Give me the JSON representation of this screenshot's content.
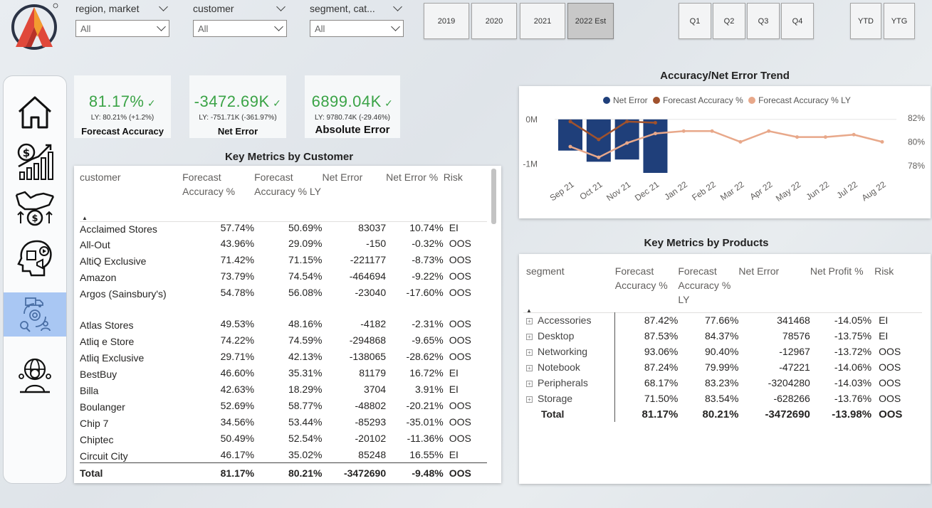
{
  "filters": [
    {
      "label": "region, market",
      "value": "All"
    },
    {
      "label": "customer",
      "value": "All"
    },
    {
      "label": "segment, cat...",
      "value": "All"
    }
  ],
  "years": [
    "2019",
    "2020",
    "2021",
    "2022 Est"
  ],
  "quarters": [
    "Q1",
    "Q2",
    "Q3",
    "Q4"
  ],
  "periods": [
    "YTD",
    "YTG"
  ],
  "kpis": [
    {
      "value": "81.17%",
      "ly": "LY: 80.21% (+1.2%)",
      "name": "Forecast Accuracy"
    },
    {
      "value": "-3472.69K",
      "ly": "LY: -751.71K (-361.97%)",
      "name": "Net Error"
    },
    {
      "value": "6899.04K",
      "ly": "LY: 9780.74K (-29.46%)",
      "name": "Absolute Error"
    }
  ],
  "customer_table": {
    "title": "Key Metrics by Customer",
    "headers": [
      "customer",
      "Forecast Accuracy %",
      "Forecast Accuracy % LY",
      "Net Error",
      "Net Error %",
      "Risk"
    ],
    "rows": [
      [
        "Acclaimed Stores",
        "57.74%",
        "50.69%",
        "83037",
        "10.74%",
        "EI"
      ],
      [
        "All-Out",
        "43.96%",
        "29.09%",
        "-150",
        "-0.32%",
        "OOS"
      ],
      [
        "AltiQ Exclusive",
        "71.42%",
        "71.15%",
        "-221177",
        "-8.73%",
        "OOS"
      ],
      [
        "Amazon",
        "73.79%",
        "74.54%",
        "-464694",
        "-9.22%",
        "OOS"
      ],
      [
        "Argos (Sainsbury's)",
        "54.78%",
        "56.08%",
        "-23040",
        "-17.60%",
        "OOS"
      ],
      [
        "Atlas Stores",
        "49.53%",
        "48.16%",
        "-4182",
        "-2.31%",
        "OOS"
      ],
      [
        "Atliq e Store",
        "74.22%",
        "74.59%",
        "-294868",
        "-9.65%",
        "OOS"
      ],
      [
        "Atliq Exclusive",
        "29.71%",
        "42.13%",
        "-138065",
        "-28.62%",
        "OOS"
      ],
      [
        "BestBuy",
        "46.60%",
        "35.31%",
        "81179",
        "16.72%",
        "EI"
      ],
      [
        "Billa",
        "42.63%",
        "18.29%",
        "3704",
        "3.91%",
        "EI"
      ],
      [
        "Boulanger",
        "52.69%",
        "58.77%",
        "-48802",
        "-20.21%",
        "OOS"
      ],
      [
        "Chip 7",
        "34.56%",
        "53.44%",
        "-85293",
        "-35.01%",
        "OOS"
      ],
      [
        "Chiptec",
        "50.49%",
        "52.54%",
        "-20102",
        "-11.36%",
        "OOS"
      ],
      [
        "Circuit City",
        "46.17%",
        "35.02%",
        "85248",
        "16.55%",
        "EI"
      ]
    ],
    "total": [
      "Total",
      "81.17%",
      "80.21%",
      "-3472690",
      "-9.48%",
      "OOS"
    ]
  },
  "product_table": {
    "title": "Key Metrics by Products",
    "headers": [
      "segment",
      "Forecast Accuracy %",
      "Forecast Accuracy % LY",
      "Net Error",
      "Net Profit %",
      "Risk"
    ],
    "rows": [
      [
        "Accessories",
        "87.42%",
        "77.66%",
        "341468",
        "-14.05%",
        "EI"
      ],
      [
        "Desktop",
        "87.53%",
        "84.37%",
        "78576",
        "-13.75%",
        "EI"
      ],
      [
        "Networking",
        "93.06%",
        "90.40%",
        "-12967",
        "-13.72%",
        "OOS"
      ],
      [
        "Notebook",
        "87.24%",
        "79.99%",
        "-47221",
        "-14.06%",
        "OOS"
      ],
      [
        "Peripherals",
        "68.17%",
        "83.23%",
        "-3204280",
        "-14.03%",
        "OOS"
      ],
      [
        "Storage",
        "71.50%",
        "83.54%",
        "-628266",
        "-13.76%",
        "OOS"
      ]
    ],
    "total": [
      "Total",
      "81.17%",
      "80.21%",
      "-3472690",
      "-13.98%",
      "OOS"
    ]
  },
  "chart_data": {
    "type": "bar",
    "title": "Accuracy/Net Error Trend",
    "categories": [
      "Sep 21",
      "Oct 21",
      "Nov 21",
      "Dec 21",
      "Jan 22",
      "Feb 22",
      "Mar 22",
      "Apr 22",
      "May 22",
      "Jun 22",
      "Jul 22",
      "Aug 22"
    ],
    "series": [
      {
        "name": "Net Error",
        "kind": "bar",
        "axis": "left",
        "color": "#1f3f7a",
        "values": [
          -0.7,
          -0.95,
          -0.9,
          -1.2,
          null,
          null,
          null,
          null,
          null,
          null,
          null,
          null
        ]
      },
      {
        "name": "Forecast Accuracy %",
        "kind": "line",
        "axis": "right",
        "color": "#a0522d",
        "values": [
          81.7,
          80.2,
          81.7,
          81.6,
          null,
          null,
          null,
          null,
          null,
          null,
          null,
          null
        ]
      },
      {
        "name": "Forecast Accuracy % LY",
        "kind": "line",
        "axis": "right",
        "color": "#e8a88a",
        "values": [
          79.6,
          78.7,
          79.9,
          80.7,
          80.9,
          80.9,
          80.0,
          80.9,
          80.4,
          80.4,
          80.6,
          80.0
        ]
      }
    ],
    "left_axis": {
      "ticks": [
        "0M",
        "-1M"
      ],
      "range": [
        -1.2,
        0.3
      ]
    },
    "right_axis": {
      "ticks": [
        "82%",
        "80%",
        "78%"
      ],
      "range": [
        77.4,
        83
      ]
    },
    "legend": "top"
  }
}
